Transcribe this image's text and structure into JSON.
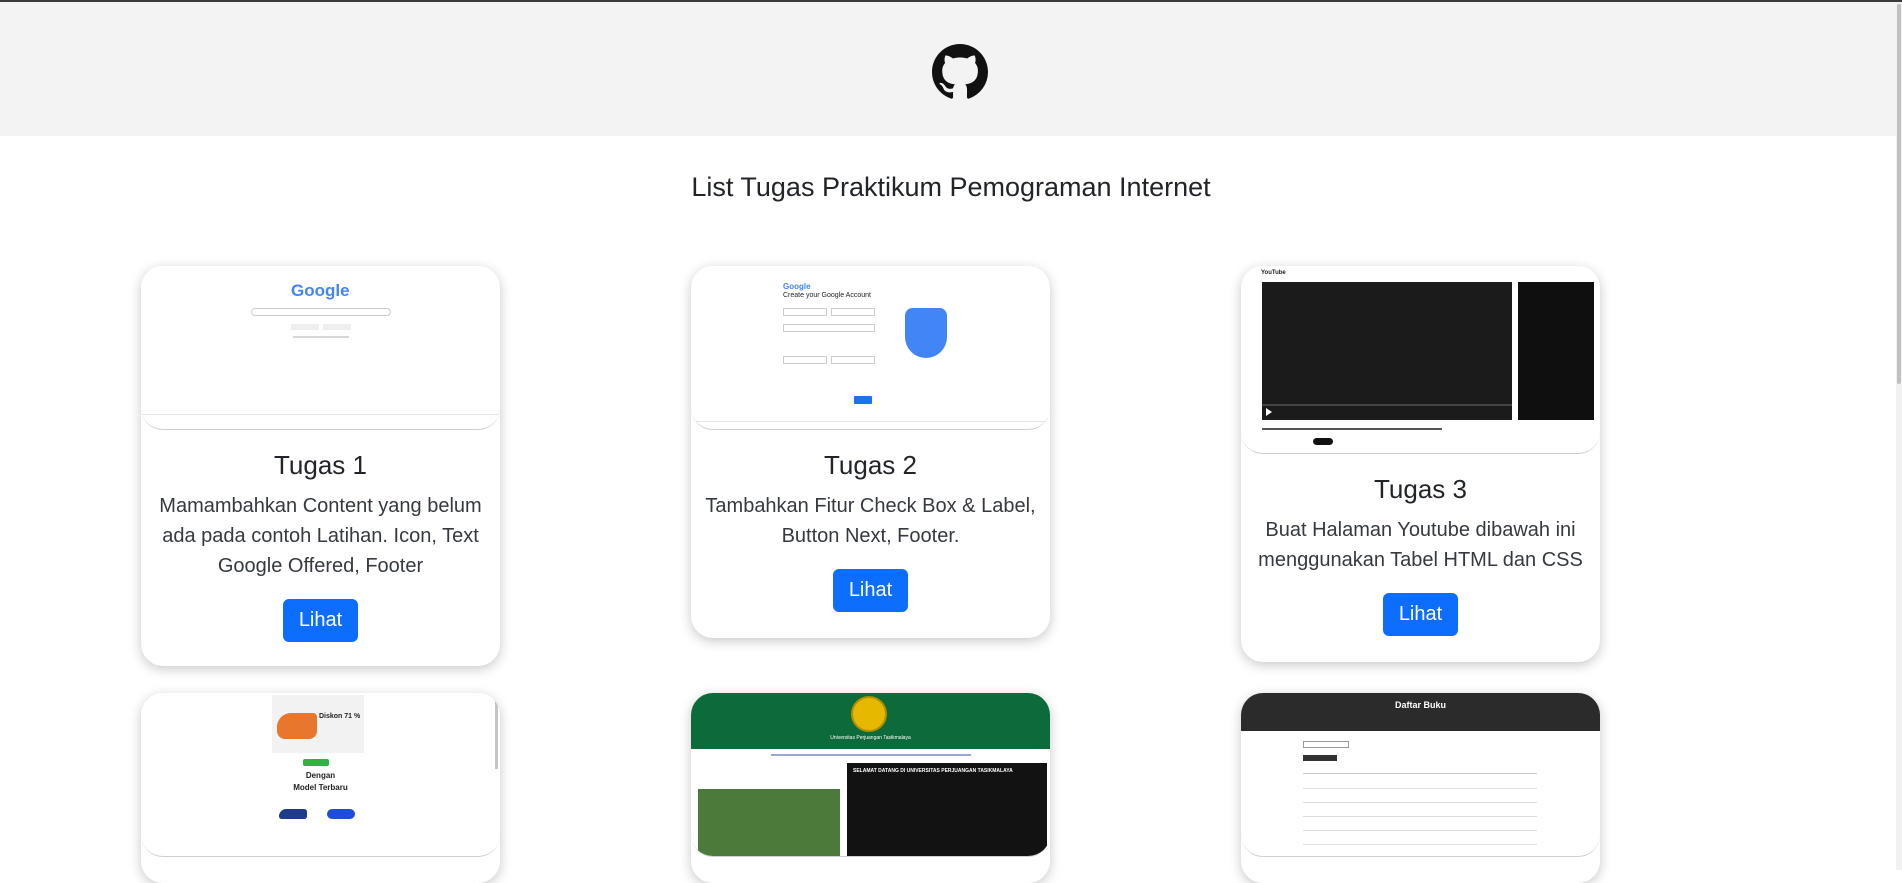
{
  "page": {
    "title": "List Tugas Praktikum Pemograman Internet"
  },
  "header": {
    "logo_icon": "github-icon"
  },
  "cards": [
    {
      "title": "Tugas 1",
      "text": "Mamambahkan Content yang belum ada pada contoh Latihan. Icon, Text Google Offered, Footer",
      "button": "Lihat",
      "thumb": {
        "logo": "Google"
      }
    },
    {
      "title": "Tugas 2",
      "text": "Tambahkan Fitur Check Box & Label, Button Next, Footer.",
      "button": "Lihat",
      "thumb": {
        "logo": "Google",
        "heading": "Create your Google Account"
      }
    },
    {
      "title": "Tugas 3",
      "text": "Buat Halaman Youtube dibawah ini menggunakan Tabel HTML dan CSS",
      "button": "Lihat",
      "thumb": {
        "logo": "YouTube"
      }
    },
    {
      "thumb": {
        "line1": "Diskon 71 %",
        "line2": "Dengan",
        "line3": "Model Terbaru"
      }
    },
    {
      "thumb": {
        "heading": "Universitas Perjuangan Tasikmalaya",
        "welcome": "SELAMAT DATANG DI UNIVERSITAS PERJUANGAN TASIKMALAYA"
      }
    },
    {
      "thumb": {
        "heading": "Daftar Buku"
      }
    }
  ],
  "colors": {
    "primary": "#0d6efd",
    "header_bg": "#f3f3f4",
    "green": "#0d6b3b",
    "dark": "#2b2b2b"
  }
}
